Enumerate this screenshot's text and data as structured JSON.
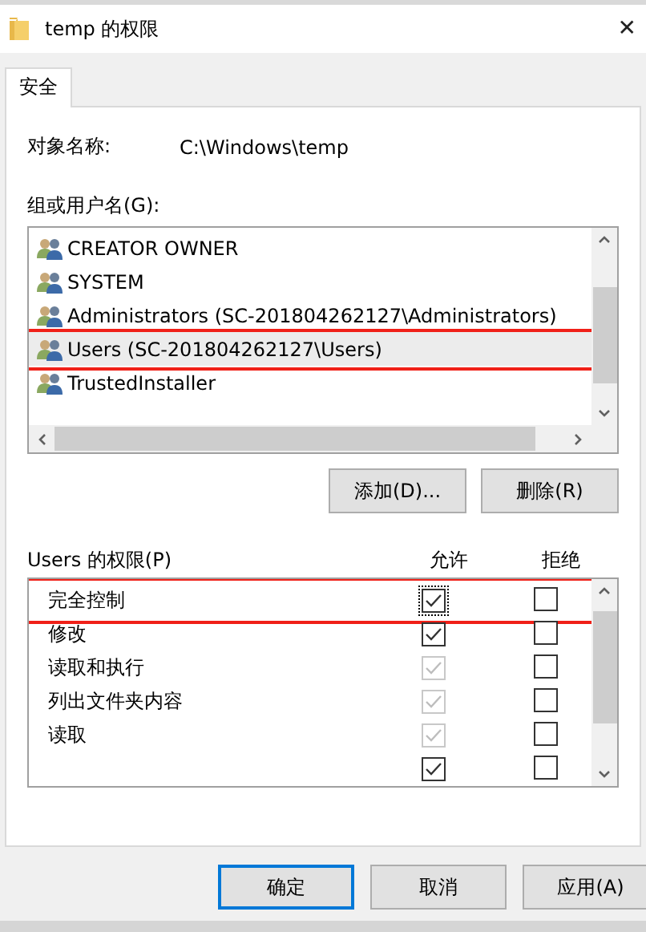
{
  "window": {
    "title": "temp 的权限",
    "close": "✕"
  },
  "tabs": [
    {
      "label": "安全",
      "selected": true
    }
  ],
  "object_name": {
    "label": "对象名称:",
    "value": "C:\\Windows\\temp"
  },
  "groups": {
    "label": "组或用户名(G):",
    "items": [
      {
        "name": "CREATOR OWNER",
        "selected": false,
        "highlighted": false
      },
      {
        "name": "SYSTEM",
        "selected": false,
        "highlighted": false
      },
      {
        "name": "Administrators (SC-201804262127\\Administrators)",
        "selected": false,
        "highlighted": false
      },
      {
        "name": "Users (SC-201804262127\\Users)",
        "selected": true,
        "highlighted": true
      },
      {
        "name": "TrustedInstaller",
        "selected": false,
        "highlighted": false
      }
    ],
    "buttons": [
      "添加(D)...",
      "删除(R)"
    ]
  },
  "permissions": {
    "label": "Users 的权限(P)",
    "allow_header": "允许",
    "deny_header": "拒绝",
    "items": [
      {
        "name": "完全控制",
        "highlighted": true,
        "allow": {
          "checked": true,
          "disabled": false,
          "focused": true
        },
        "deny": {
          "checked": false,
          "disabled": false,
          "focused": false
        }
      },
      {
        "name": "修改",
        "highlighted": false,
        "allow": {
          "checked": true,
          "disabled": false,
          "focused": false
        },
        "deny": {
          "checked": false,
          "disabled": false,
          "focused": false
        }
      },
      {
        "name": "读取和执行",
        "highlighted": false,
        "allow": {
          "checked": true,
          "disabled": true,
          "focused": false
        },
        "deny": {
          "checked": false,
          "disabled": false,
          "focused": false
        }
      },
      {
        "name": "列出文件夹内容",
        "highlighted": false,
        "allow": {
          "checked": true,
          "disabled": true,
          "focused": false
        },
        "deny": {
          "checked": false,
          "disabled": false,
          "focused": false
        }
      },
      {
        "name": "读取",
        "highlighted": false,
        "allow": {
          "checked": true,
          "disabled": true,
          "focused": false
        },
        "deny": {
          "checked": false,
          "disabled": false,
          "focused": false
        }
      },
      {
        "allow": {
          "checked": true,
          "disabled": false,
          "focused": false
        },
        "deny": {
          "checked": false,
          "disabled": false,
          "focused": false
        },
        "highlighted": false
      }
    ]
  },
  "footer_buttons": [
    {
      "label": "确定",
      "default": true
    },
    {
      "label": "取消",
      "default": false
    },
    {
      "label": "应用(A)",
      "default": false
    }
  ]
}
